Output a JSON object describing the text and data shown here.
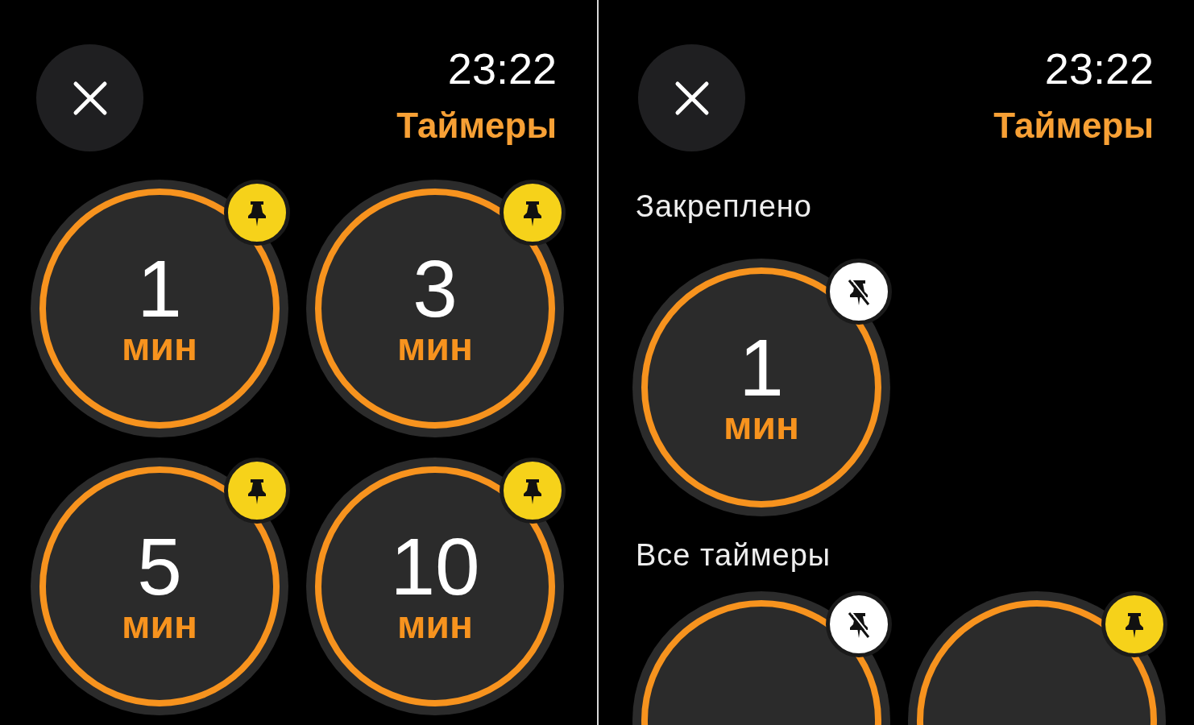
{
  "screens": [
    {
      "time": "23:22",
      "title": "Таймеры",
      "groups": [
        {
          "timers": [
            {
              "value": "1",
              "unit": "мин",
              "pinned": false
            },
            {
              "value": "3",
              "unit": "мин",
              "pinned": false
            },
            {
              "value": "5",
              "unit": "мин",
              "pinned": false
            },
            {
              "value": "10",
              "unit": "мин",
              "pinned": false
            }
          ]
        }
      ]
    },
    {
      "time": "23:22",
      "title": "Таймеры",
      "groups": [
        {
          "heading": "Закреплено",
          "timers": [
            {
              "value": "1",
              "unit": "мин",
              "pinned": true
            }
          ]
        },
        {
          "heading": "Все таймеры",
          "timers": [
            {
              "pinned": true
            },
            {
              "pinned": false
            }
          ]
        }
      ]
    }
  ]
}
